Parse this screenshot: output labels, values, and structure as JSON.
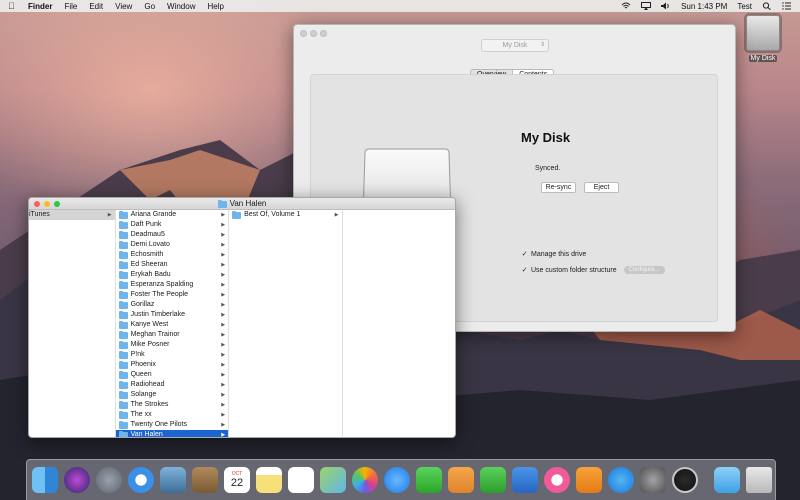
{
  "menubar": {
    "app_name": "Finder",
    "menus": [
      "File",
      "Edit",
      "View",
      "Go",
      "Window",
      "Help"
    ],
    "clock": "Sun 1:43 PM",
    "user": "Test"
  },
  "desktop": {
    "disk_label": "My Disk"
  },
  "disk_window": {
    "disk_select_value": "My Disk",
    "tabs": [
      "Overview",
      "Contents"
    ],
    "title": "My Disk",
    "status": "Synced.",
    "resync_label": "Re-sync",
    "eject_label": "Eject",
    "manage_label": "Manage this drive",
    "custom_structure_label": "Use custom folder structure",
    "configure_label": "Configure..."
  },
  "finder": {
    "title": "Van Halen",
    "col1": [
      "iTunes"
    ],
    "col2": [
      "Ariana Grande",
      "Daft Punk",
      "Deadmau5",
      "Demi Lovato",
      "Echosmith",
      "Ed Sheeran",
      "Erykah Badu",
      "Esperanza Spalding",
      "Foster The People",
      "Gorillaz",
      "Justin Timberlake",
      "Kanye West",
      "Meghan Trainor",
      "Mike Posner",
      "P!nk",
      "Phoenix",
      "Queen",
      "Radiohead",
      "Solange",
      "The Strokes",
      "The xx",
      "Twenty One Pilots",
      "Van Halen"
    ],
    "col3": [
      "Best Of, Volume 1"
    ]
  },
  "dock": {
    "icons": [
      "finder-icon",
      "siri-icon",
      "launchpad-icon",
      "safari-icon",
      "mail-icon",
      "contacts-icon",
      "calendar-icon",
      "notes-icon",
      "reminders-icon",
      "maps-icon",
      "photos-icon",
      "messages-icon",
      "facetime-icon",
      "pages-icon",
      "numbers-icon",
      "keynote-icon",
      "itunes-icon",
      "ibooks-icon",
      "app-store-icon",
      "system-preferences-icon",
      "my-disk-app-icon",
      "downloads-folder-icon",
      "trash-icon"
    ],
    "calendar_month": "OCT",
    "calendar_day": "22"
  }
}
